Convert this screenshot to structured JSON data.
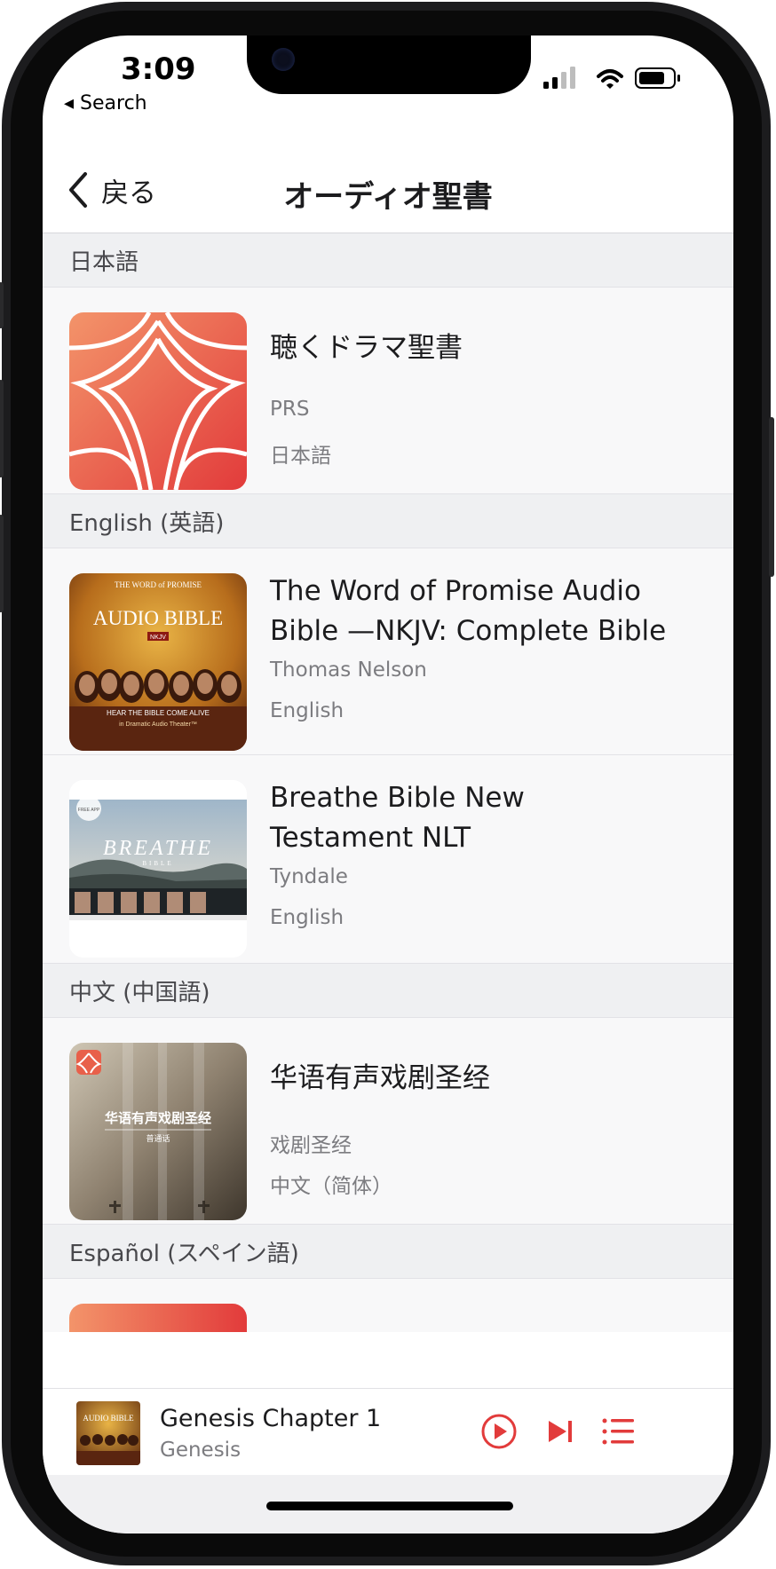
{
  "status_bar": {
    "time": "3:09",
    "back_app": "◂ Search"
  },
  "nav": {
    "back_label": "戻る",
    "title": "オーディオ聖書"
  },
  "sections": [
    {
      "header": "日本語",
      "items": [
        {
          "title": "聴くドラマ聖書",
          "author": "PRS",
          "language": "日本語",
          "cover": "drama-bible-logo"
        }
      ]
    },
    {
      "header": "English (英語)",
      "items": [
        {
          "title": "The Word of Promise Audio Bible —NKJV: Complete Bible",
          "author": "Thomas Nelson",
          "language": "English",
          "cover": "word-of-promise-cover"
        },
        {
          "title": "Breathe Bible New Testament NLT",
          "author": "Tyndale",
          "language": "English",
          "cover": "breathe-bible-cover"
        }
      ]
    },
    {
      "header": "中文 (中国語)",
      "items": [
        {
          "title": "华语有声戏剧圣经",
          "author": "戏剧圣经",
          "language": "中文（简体）",
          "cover": "chinese-drama-bible-cover"
        }
      ]
    },
    {
      "header": "Español (スペイン語)",
      "items": []
    }
  ],
  "covers_text": {
    "wop_top": "THE WORD of PROMISE",
    "wop_main": "AUDIO BIBLE",
    "wop_badge": "NKJV",
    "wop_tagline": "HEAR THE BIBLE COME ALIVE",
    "wop_tagline2": "in Dramatic Audio Theater™",
    "breathe_main": "BREATHE",
    "breathe_sub": "BIBLE",
    "breathe_badge": "FREE APP",
    "chinese_main": "华语有声戏剧圣经",
    "chinese_sub": "普通话"
  },
  "mini_player": {
    "title": "Genesis Chapter 1",
    "subtitle": "Genesis",
    "art_text": "AUDIO BIBLE"
  },
  "colors": {
    "accent": "#e23b3b",
    "section_bg": "#eff0f2",
    "row_bg": "#f8f8f9"
  }
}
